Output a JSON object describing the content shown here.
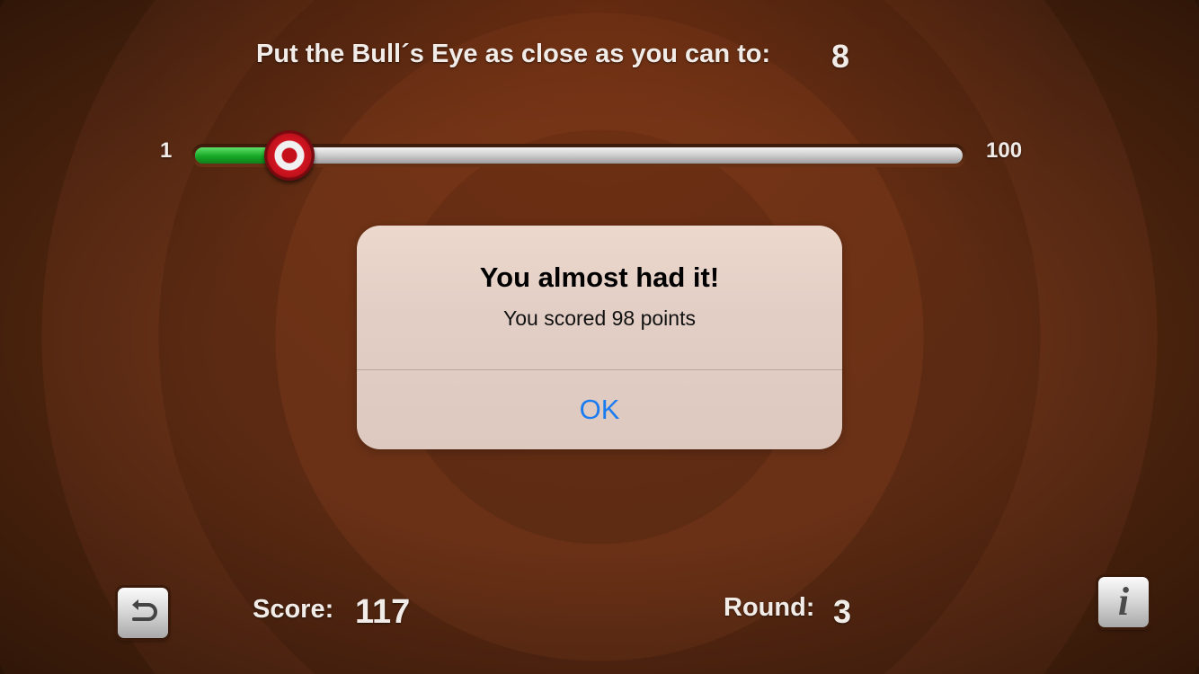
{
  "header": {
    "target_label": "Put the Bull´s Eye as close as you can to:",
    "target_value": "8"
  },
  "slider": {
    "min_label": "1",
    "max_label": "100",
    "min": 1,
    "max": 100,
    "value": 11
  },
  "dialog": {
    "title": "You almost had it!",
    "message": "You scored 98 points",
    "ok_label": "OK"
  },
  "footer": {
    "restart_icon": "restart-arrow-icon",
    "score_label": "Score:",
    "score_value": "117",
    "round_label": "Round:",
    "round_value": "3",
    "info_icon": "info-icon",
    "info_glyph": "i"
  },
  "colors": {
    "background": "#5a2a12",
    "slider_fill": "#17a826",
    "thumb_red": "#c5101a",
    "ok_blue": "#1a7cf0",
    "dialog_bg": "#e2cec4"
  }
}
